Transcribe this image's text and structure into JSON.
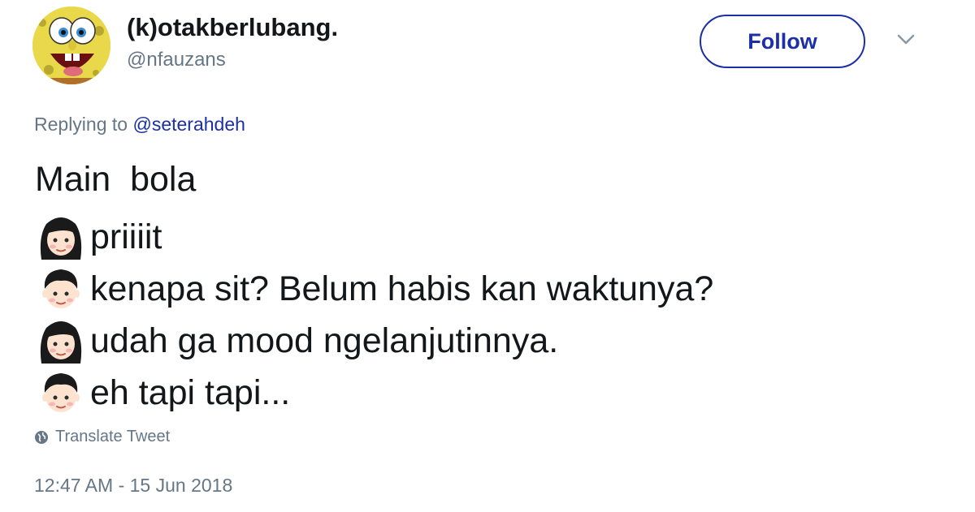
{
  "tweet": {
    "display_name": "(k)otakberlubang.",
    "handle": "@nfauzans",
    "avatar_icon": "spongebob-avatar-icon",
    "follow_label": "Follow",
    "menu_icon": "chevron-down-icon",
    "replying_prefix": "Replying to ",
    "replying_mention": "@seterahdeh",
    "lines": [
      {
        "emoji": "",
        "text": "Main  bola"
      },
      {
        "emoji": "woman-face-icon",
        "text": "priiiit"
      },
      {
        "emoji": "boy-face-icon",
        "text": "kenapa sit? Belum habis kan waktunya?"
      },
      {
        "emoji": "woman-face-icon",
        "text": "udah ga mood ngelanjutinnya."
      },
      {
        "emoji": "boy-face-icon",
        "text": "eh tapi tapi..."
      }
    ],
    "translate_label": "Translate Tweet",
    "translate_icon": "globe-icon",
    "timestamp": "12:47 AM - 15 Jun 2018"
  },
  "colors": {
    "text": "#14171a",
    "secondary": "#657786",
    "link": "#1b2fa8"
  }
}
